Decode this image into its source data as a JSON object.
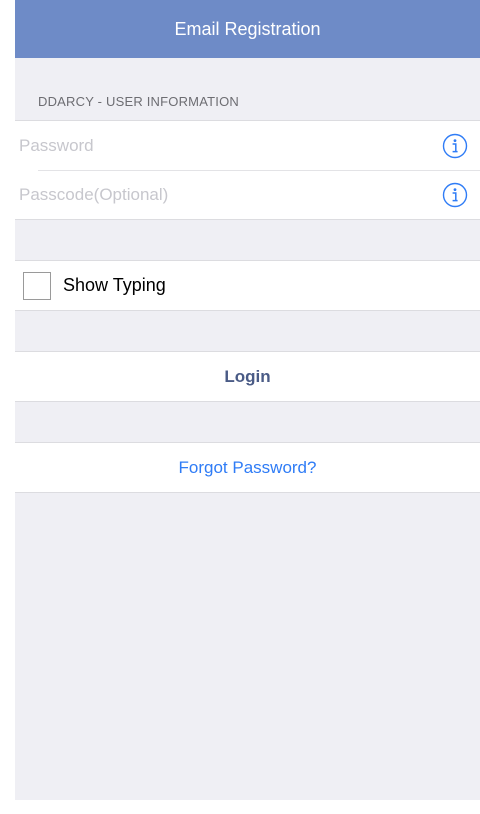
{
  "navbar": {
    "title": "Email Registration"
  },
  "user_info": {
    "section_header": "DDARCY - USER INFORMATION",
    "password_placeholder": "Password",
    "passcode_placeholder": "Passcode(Optional)",
    "info_icon": "info-circle"
  },
  "options": {
    "show_typing_label": "Show Typing",
    "show_typing_checked": false
  },
  "actions": {
    "login_label": "Login",
    "forgot_password_label": "Forgot Password?"
  },
  "colors": {
    "navbar_bg": "#6e8bc7",
    "background": "#efeff4",
    "login_text": "#4a5b86",
    "link": "#2f7cf6",
    "info_icon": "#2f7cf6"
  }
}
